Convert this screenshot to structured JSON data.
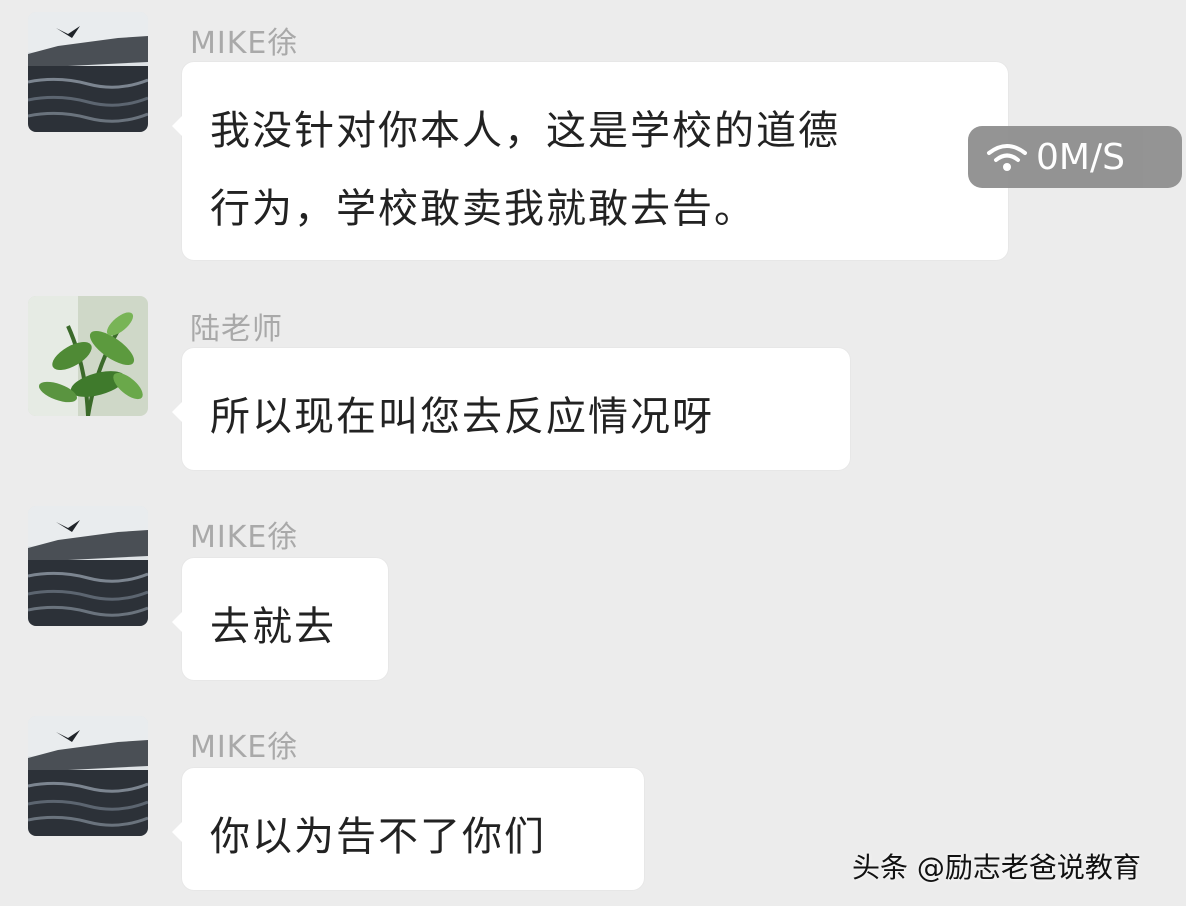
{
  "messages": [
    {
      "sender": "MIKE徐",
      "avatar": "lake-landscape-avatar",
      "lines": [
        "我没针对你本人，这是学校的道德",
        "行为，学校敢卖我就敢去告。"
      ]
    },
    {
      "sender": "陆老师",
      "avatar": "green-plant-avatar",
      "lines": [
        "所以现在叫您去反应情况呀"
      ]
    },
    {
      "sender": "MIKE徐",
      "avatar": "lake-landscape-avatar",
      "lines": [
        "去就去"
      ]
    },
    {
      "sender": "MIKE徐",
      "avatar": "lake-landscape-avatar",
      "lines": [
        "你以为告不了你们"
      ]
    }
  ],
  "status": {
    "network_speed": "0M/S",
    "icon": "wifi-icon"
  },
  "watermark": "头条 @励志老爸说教育",
  "colors": {
    "background": "#ececec",
    "bubble": "#ffffff",
    "sender_text": "#a9a9a9",
    "message_text": "#222222",
    "status_pill": "#8f8f8f"
  }
}
